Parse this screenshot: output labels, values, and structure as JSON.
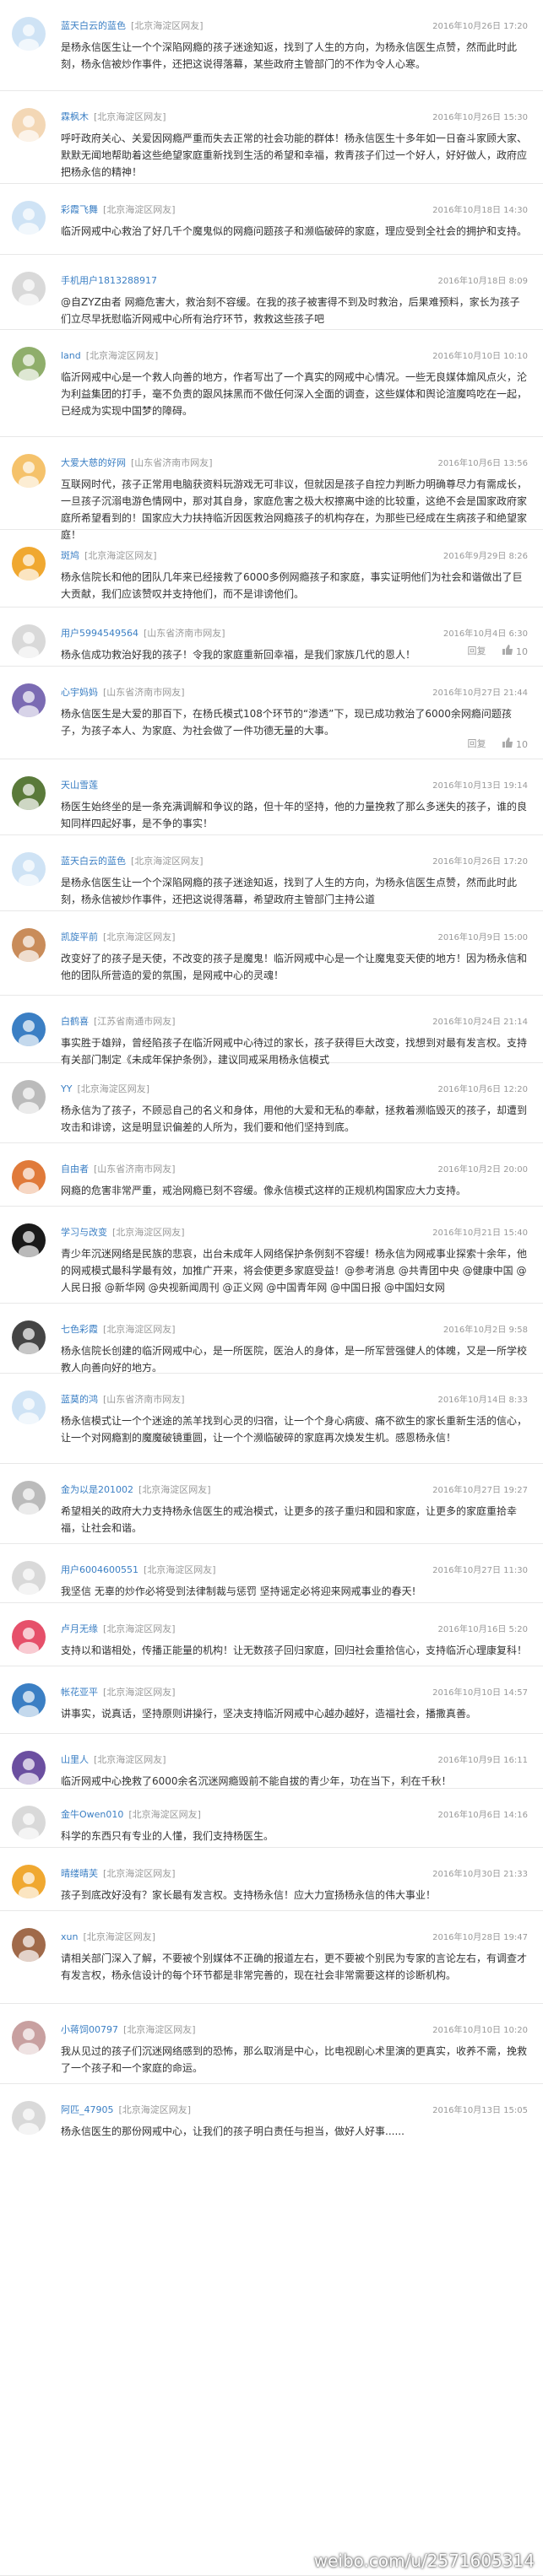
{
  "watermark": "weibo.com/u/2571605314",
  "reply_label": "回复",
  "comments": [
    {
      "user": "蓝天白云的蓝色",
      "loc": "[北京海淀区网友]",
      "time": "2016年10月26日 17:20",
      "text": "是杨永信医生让一个个深陷网瘾的孩子迷途知返，找到了人生的方向，为杨永信医生点赞，然而此时此刻，杨永信被炒作事件，还把这说得落幕，某些政府主管部门的不作为令人心寒。",
      "tools": false
    },
    {
      "user": "霖枫木",
      "loc": "[北京海淀区网友]",
      "time": "2016年10月26日 15:30",
      "text": "呼吁政府关心、关爱因网瘾严重而失去正常的社会功能的群体！杨永信医生十多年如一日奋斗家顾大家、默默无闻地帮助着这些绝望家庭重新找到生活的希望和幸福，救青孩子们过一个好人，好好做人，政府应把杨永信的精神！",
      "tools": false
    },
    {
      "user": "彩霞飞舞",
      "loc": "[北京海淀区网友]",
      "time": "2016年10月18日 14:30",
      "text": "临沂网戒中心救治了好几千个魔鬼似的网瘾问题孩子和濒临破碎的家庭，理应受到全社会的拥护和支持。",
      "tools": false
    },
    {
      "user": "手机用户1813288917",
      "loc": "",
      "time": "2016年10月18日 8:09",
      "text": "@自ZYZ由者 网瘾危害大，救治刻不容缓。在我的孩子被害得不到及时救治，后果难预料，家长为孩子们立尽早抚慰临沂网戒中心所有治疗环节，救救这些孩子吧",
      "tools": false
    },
    {
      "user": "land",
      "loc": "[北京海淀区网友]",
      "time": "2016年10月10日 10:10",
      "text": "临沂网戒中心是一个救人向善的地方，作者写出了一个真实的网戒中心情况。一些无良媒体煽风点火，沦为利益集团的打手，毫不负责的跟风抹黑而不做任何深入全面的调查，这些媒体和舆论渲魔鸣吃在一起，已经成为实现中国梦的障碍。",
      "tools": false
    },
    {
      "user": "大爱大慈的好网",
      "loc": "[山东省济南市网友]",
      "time": "2016年10月6日 13:56",
      "text": "互联网时代，孩子正常用电脑获资料玩游戏无可非议，但就因是孩子自控力判断力明确尊尽力有需成长，一旦孩子沉溺电游色情网中，那对其自身，家庭危害之极大权擦离中途的比较重，这绝不会是国家政府家庭所希望看到的！国家应大力扶持临沂因医救治网瘾孩子的机构存在，为那些已经成在生病孩子和绝望家庭！",
      "tools": false
    },
    {
      "user": "斑鸠",
      "loc": "[北京海淀区网友]",
      "time": "2016年9月29日 8:26",
      "text": "杨永信院长和他的团队几年来已经接救了6000多例网瘾孩子和家庭，事实证明他们为社会和谐做出了巨大贡献，我们应该赞叹并支持他们，而不是诽谤他们。",
      "tools": false
    },
    {
      "user": "用户5994549564",
      "loc": "[山东省济南市网友]",
      "time": "2016年10月4日 6:30",
      "text": "杨永信成功救治好我的孩子！令我的家庭重新回幸福，是我们家族几代的恩人！",
      "tools": true,
      "likes": "10"
    },
    {
      "user": "心宇妈妈",
      "loc": "[山东省济南市网友]",
      "time": "2016年10月27日 21:44",
      "text": "杨永信医生是大爱的那百下，在杨氏模式108个环节的“渗透”下，现已成功救治了6000余网瘾问题孩子，为孩子本人、为家庭、为社会做了一件功德无量的大事。",
      "tools": true,
      "likes": "10"
    },
    {
      "user": "天山雪莲",
      "loc": "",
      "time": "2016年10月13日 19:14",
      "text": "杨医生始终坐的是一条充满调解和争议的路，但十年的坚持，他的力量挽救了那么多迷失的孩子，谁的良知同样四起好事，是不争的事实！",
      "tools": false
    },
    {
      "user": "蓝天白云的蓝色",
      "loc": "[北京海淀区网友]",
      "time": "2016年10月26日 17:20",
      "text": "是杨永信医生让一个个深陷网瘾的孩子迷途知返，找到了人生的方向，为杨永信医生点赞，然而此时此刻，杨永信被炒作事件，还把这说得落幕，希望政府主管部门主持公道",
      "tools": false
    },
    {
      "user": "凯旋平前",
      "loc": "[北京海淀区网友]",
      "time": "2016年10月9日 15:00",
      "text": "改变好了的孩子是天使，不改变的孩子是魔鬼！临沂网戒中心是一个让魔鬼变天使的地方！因为杨永信和他的团队所营造的爱的氛围，是网戒中心的灵魂！",
      "tools": false
    },
    {
      "user": "白鹤喜",
      "loc": "[江苏省南通市网友]",
      "time": "2016年10月24日 21:14",
      "text": "事实胜于雄辩，曾经陷孩子在临沂网戒中心待过的家长，孩子获得巨大改变，找想到对最有发言权。支持有关部门制定《未成年保护条例》，建议同戒采用杨永信模式",
      "tools": false
    },
    {
      "user": "YY",
      "loc": "[北京海淀区网友]",
      "time": "2016年10月6日 12:20",
      "text": "杨永信为了孩子，不顾忌自己的名义和身体，用他的大爱和无私的奉献，拯救着濒临毁灭的孩子，却遭到攻击和诽谤，这是明显识偏差的人所为，我们要和他们坚持到底。",
      "tools": false
    },
    {
      "user": "自由者",
      "loc": "[山东省济南市网友]",
      "time": "2016年10月2日 20:00",
      "text": "网瘾的危害非常严重，戒治网瘾已刻不容缓。像永信模式这样的正规机构国家应大力支持。",
      "tools": false
    },
    {
      "user": "学习与改变",
      "loc": "[北京海淀区网友]",
      "time": "2016年10月21日 15:40",
      "text": "青少年沉迷网络是民族的悲哀，出台未成年人网络保护条例刻不容缓！杨永信为网戒事业探索十余年，他的网戒模式最科学最有效，加推广开来，将会使更多家庭受益！@参考消息 @共青团中央 @健康中国 @人民日报 @新华网 @央视新闻周刊 @正义网 @中国青年网 @中国日报 @中国妇女网",
      "tools": false
    },
    {
      "user": "七色彩霞",
      "loc": "[北京海淀区网友]",
      "time": "2016年10月2日 9:58",
      "text": "杨永信院长创建的临沂网戒中心，是一所医院，医治人的身体，是一所军营强健人的体魄，又是一所学校教人向善向好的地方。",
      "tools": false
    },
    {
      "user": "蓝莫的鸿",
      "loc": "[山东省济南市网友]",
      "time": "2016年10月14日 8:33",
      "text": "杨永信模式让一个个迷途的羔羊找到心灵的归宿，让一个个身心病疲、痛不欲生的家长重新生活的信心，让一个对网瘾割的魔魔破镜重圆，让一个个濒临破碎的家庭再次焕发生机。感恩杨永信！",
      "tools": false
    },
    {
      "user": "金为以是201002",
      "loc": "[北京海淀区网友]",
      "time": "2016年10月27日 19:27",
      "text": "希望相关的政府大力支持杨永信医生的戒治模式，让更多的孩子重归和园和家庭，让更多的家庭重拾幸福，让社会和谐。",
      "tools": false
    },
    {
      "user": "用户6004600551",
      "loc": "[北京海淀区网友]",
      "time": "2016年10月27日 11:30",
      "text": "我坚信 无辜的炒作必将受到法律制裁与惩罚 坚持谣定必将迎来网戒事业的春天!",
      "tools": false
    },
    {
      "user": "卢月无缘",
      "loc": "[北京海淀区网友]",
      "time": "2016年10月16日 5:20",
      "text": "支持以和谐相处，传播正能量的机构！让无数孩子回归家庭，回归社会重拾信心，支持临沂心理康复科！",
      "tools": false
    },
    {
      "user": "帐花亚平",
      "loc": "[北京海淀区网友]",
      "time": "2016年10月10日 14:57",
      "text": "讲事实，说真话，坚持原则讲操行，坚决支持临沂网戒中心越办越好，造福社会，播撒真善。",
      "tools": false
    },
    {
      "user": "山里人",
      "loc": "[北京海淀区网友]",
      "time": "2016年10月9日 16:11",
      "text": "临沂网戒中心挽救了6000余名沉迷网瘾毁前不能自拔的青少年，功在当下，利在千秋！",
      "tools": false
    },
    {
      "user": "金牛Owen010",
      "loc": "[北京海淀区网友]",
      "time": "2016年10月6日 14:16",
      "text": "科学的东西只有专业的人懂，我们支持杨医生。",
      "tools": false
    },
    {
      "user": "晴缕晴芙",
      "loc": "[北京海淀区网友]",
      "time": "2016年10月30日 21:33",
      "text": "孩子到底改好没有？家长最有发言权。支持杨永信！应大力宣扬杨永信的伟大事业！",
      "tools": false
    },
    {
      "user": "xun",
      "loc": "[北京海淀区网友]",
      "time": "2016年10月28日 19:47",
      "text": "请相关部门深入了解，不要被个别媒体不正确的报道左右，更不要被个别民为专家的言论左右，有调查才有发言权，杨永信设计的每个环节都是非常完善的，现在社会非常需要这样的诊断机构。",
      "tools": false
    },
    {
      "user": "小蒋饲00797",
      "loc": "[北京海淀区网友]",
      "time": "2016年10月10日 10:20",
      "text": "我从见过的孩子们沉迷网络感到的恐怖，那么取消是中心，比电视剧心术里演的更真实，收养不需，挽救了一个孩子和一个家庭的命运。",
      "tools": false
    },
    {
      "user": "阿匹_47905",
      "loc": "[北京海淀区网友]",
      "time": "2016年10月13日 15:05",
      "text": "杨永信医生的那份网戒中心，让我们的孩子明白责任与担当，做好人好事......",
      "tools": false
    }
  ]
}
